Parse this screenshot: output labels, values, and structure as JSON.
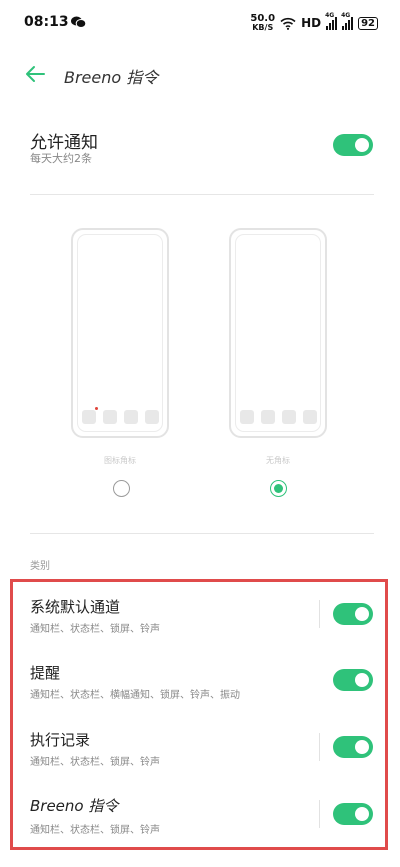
{
  "status_bar": {
    "time": "08:13",
    "net_speed_value": "50.0",
    "net_speed_unit": "KB/S",
    "hd": "HD",
    "sig1": "4G",
    "sig2": "4G",
    "battery": "92"
  },
  "header": {
    "title": "Breeno 指令"
  },
  "allow": {
    "title": "允许通知",
    "subtitle": "每天大约2条",
    "enabled": true
  },
  "previews": [
    {
      "label": "图标角标",
      "selected": false
    },
    {
      "label": "无角标",
      "selected": true
    }
  ],
  "section_label": "类别",
  "categories": [
    {
      "title": "系统默认通道",
      "desc": "通知栏、状态栏、锁屏、铃声",
      "enabled": true
    },
    {
      "title": "提醒",
      "desc": "通知栏、状态栏、横幅通知、锁屏、铃声、振动",
      "enabled": true
    },
    {
      "title": "执行记录",
      "desc": "通知栏、状态栏、锁屏、铃声",
      "enabled": true
    },
    {
      "title": "Breeno 指令",
      "desc": "通知栏、状态栏、锁屏、铃声",
      "enabled": true
    }
  ],
  "colors": {
    "accent": "#2fc27a",
    "highlight_border": "#e04b4b"
  }
}
